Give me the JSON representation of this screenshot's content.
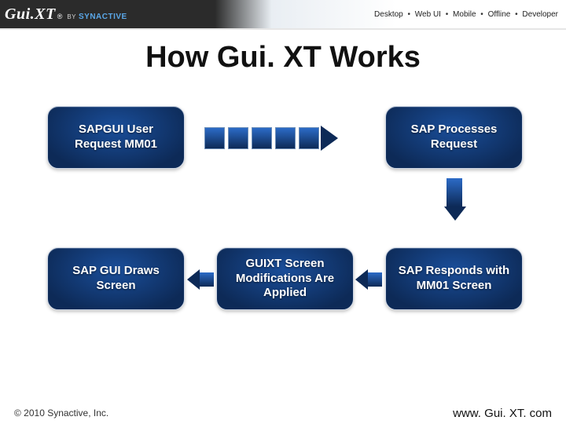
{
  "brand": {
    "name": "Gui.XT",
    "reg": "®",
    "by": "BY",
    "company": "SYNACTIVE"
  },
  "nav": {
    "items": [
      "Desktop",
      "Web UI",
      "Mobile",
      "Offline",
      "Developer"
    ],
    "sep": "•"
  },
  "title": "How Gui. XT Works",
  "flow": {
    "step1": "SAPGUI User Request MM01",
    "step2": "SAP Processes Request",
    "step3": "SAP Responds with MM01 Screen",
    "step4": "GUIXT Screen Modifications Are Applied",
    "step5": "SAP GUI Draws Screen"
  },
  "footer": {
    "copyright": "© 2010 Synactive, Inc.",
    "url": "www. Gui. XT. com"
  }
}
